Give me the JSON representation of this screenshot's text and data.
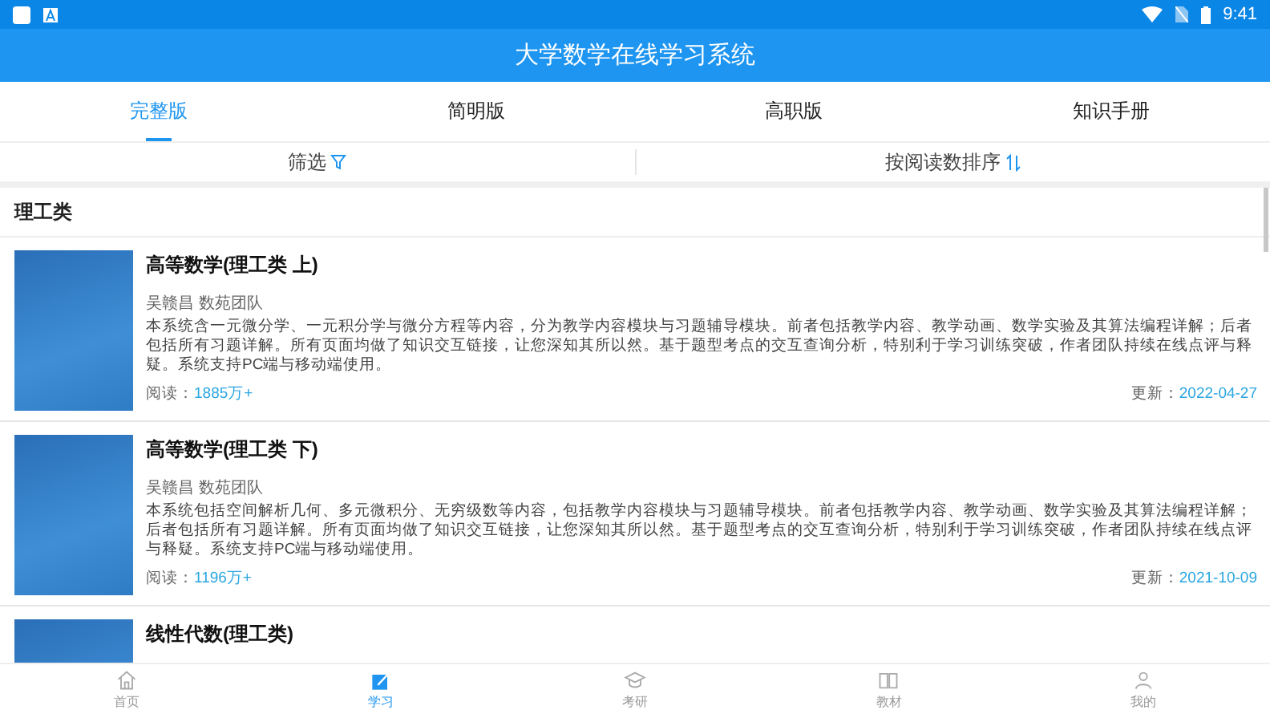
{
  "status_bar": {
    "time": "9:41"
  },
  "app_bar": {
    "title": "大学数学在线学习系统"
  },
  "tabs": [
    {
      "label": "完整版",
      "selected": true
    },
    {
      "label": "简明版",
      "selected": false
    },
    {
      "label": "高职版",
      "selected": false
    },
    {
      "label": "知识手册",
      "selected": false
    }
  ],
  "filter_bar": {
    "filter": "筛选",
    "sort": "按阅读数排序"
  },
  "section": {
    "title": "理工类"
  },
  "books": [
    {
      "title": "高等数学(理工类 上)",
      "authors": "吴赣昌 数苑团队",
      "description": "本系统含一元微分学、一元积分学与微分方程等内容，分为教学内容模块与习题辅导模块。前者包括教学内容、教学动画、数学实验及其算法编程详解；后者包括所有习题详解。所有页面均做了知识交互链接，让您深知其所以然。基于题型考点的交互查询分析，特别利于学习训练突破，作者团队持续在线点评与释疑。系统支持PC端与移动端使用。",
      "reads_label": "阅读：",
      "reads": "1885万+",
      "updated_label": "更新：",
      "updated": "2022-04-27"
    },
    {
      "title": "高等数学(理工类 下)",
      "authors": "吴赣昌 数苑团队",
      "description": "本系统包括空间解析几何、多元微积分、无穷级数等内容，包括教学内容模块与习题辅导模块。前者包括教学内容、教学动画、数学实验及其算法编程详解；后者包括所有习题详解。所有页面均做了知识交互链接，让您深知其所以然。基于题型考点的交互查询分析，特别利于学习训练突破，作者团队持续在线点评与释疑。系统支持PC端与移动端使用。",
      "reads_label": "阅读：",
      "reads": "1196万+",
      "updated_label": "更新：",
      "updated": "2021-10-09"
    },
    {
      "title": "线性代数(理工类)"
    }
  ],
  "bottom_nav": [
    {
      "kind": "home",
      "label": "首页",
      "selected": false
    },
    {
      "kind": "study",
      "label": "学习",
      "selected": true
    },
    {
      "kind": "exam",
      "label": "考研",
      "selected": false
    },
    {
      "kind": "book",
      "label": "教材",
      "selected": false
    },
    {
      "kind": "me",
      "label": "我的",
      "selected": false
    }
  ]
}
